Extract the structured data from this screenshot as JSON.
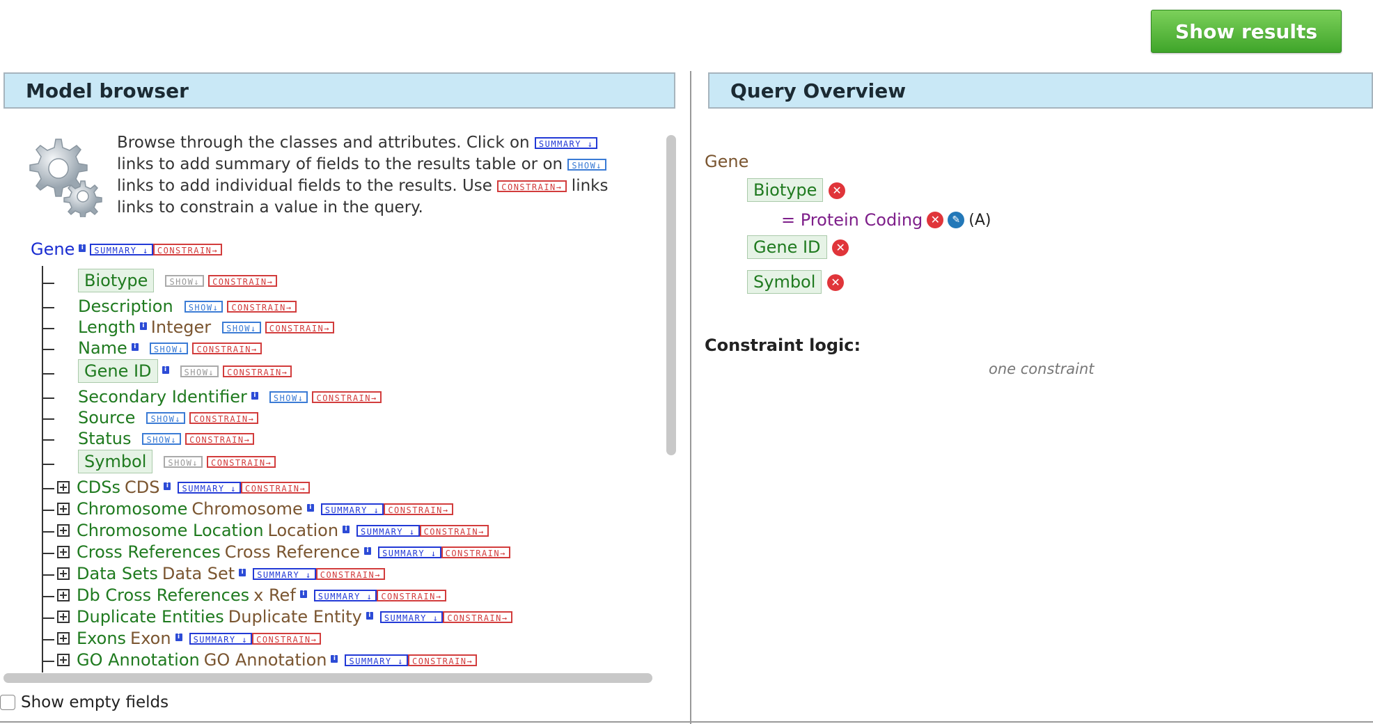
{
  "top": {
    "show_results_label": "Show results"
  },
  "model_browser": {
    "title": "Model browser",
    "help": {
      "p1": "Browse through the classes and attributes. Click on",
      "p2": "links to add summary of fields to the results table or on",
      "p3": "links to add individual fields to the results. Use",
      "p4": "links to constrain a value in the query."
    },
    "tags": {
      "summary": "SUMMARY ↓",
      "show": "SHOW↓",
      "constrain": "CONSTRAIN→",
      "info": "i"
    },
    "root": "Gene",
    "attributes": [
      {
        "name": "Biotype",
        "type": "",
        "info": false,
        "boxed": true,
        "show_disabled": true
      },
      {
        "name": "Description",
        "type": "",
        "info": false,
        "boxed": false,
        "show_disabled": false
      },
      {
        "name": "Length",
        "type": "Integer",
        "info": true,
        "boxed": false,
        "show_disabled": false
      },
      {
        "name": "Name",
        "type": "",
        "info": true,
        "boxed": false,
        "show_disabled": false
      },
      {
        "name": "Gene ID",
        "type": "",
        "info": true,
        "boxed": true,
        "show_disabled": true
      },
      {
        "name": "Secondary Identifier",
        "type": "",
        "info": true,
        "boxed": false,
        "show_disabled": false
      },
      {
        "name": "Source",
        "type": "",
        "info": false,
        "boxed": false,
        "show_disabled": false
      },
      {
        "name": "Status",
        "type": "",
        "info": false,
        "boxed": false,
        "show_disabled": false
      },
      {
        "name": "Symbol",
        "type": "",
        "info": false,
        "boxed": true,
        "show_disabled": true
      }
    ],
    "references": [
      {
        "name": "CDSs",
        "type": "CDS"
      },
      {
        "name": "Chromosome",
        "type": "Chromosome"
      },
      {
        "name": "Chromosome Location",
        "type": "Location"
      },
      {
        "name": "Cross References",
        "type": "Cross Reference"
      },
      {
        "name": "Data Sets",
        "type": "Data Set"
      },
      {
        "name": "Db Cross References",
        "type": "x Ref"
      },
      {
        "name": "Duplicate Entities",
        "type": "Duplicate Entity"
      },
      {
        "name": "Exons",
        "type": "Exon"
      },
      {
        "name": "GO Annotation",
        "type": "GO Annotation"
      }
    ],
    "show_empty_fields": "Show empty fields"
  },
  "query_overview": {
    "title": "Query Overview",
    "root": "Gene",
    "fields": [
      {
        "name": "Biotype",
        "constraint": "= Protein Coding",
        "code": "(A)"
      },
      {
        "name": "Gene ID"
      },
      {
        "name": "Symbol"
      }
    ],
    "constraint_logic_label": "Constraint logic:",
    "constraint_logic_value": "one constraint"
  },
  "colors": {
    "accent_green": "#3fa52a",
    "header_bg": "#c9e8f6",
    "field_green": "#1f7a1f",
    "type_brown": "#7a5530",
    "remove_red": "#e0353a"
  }
}
